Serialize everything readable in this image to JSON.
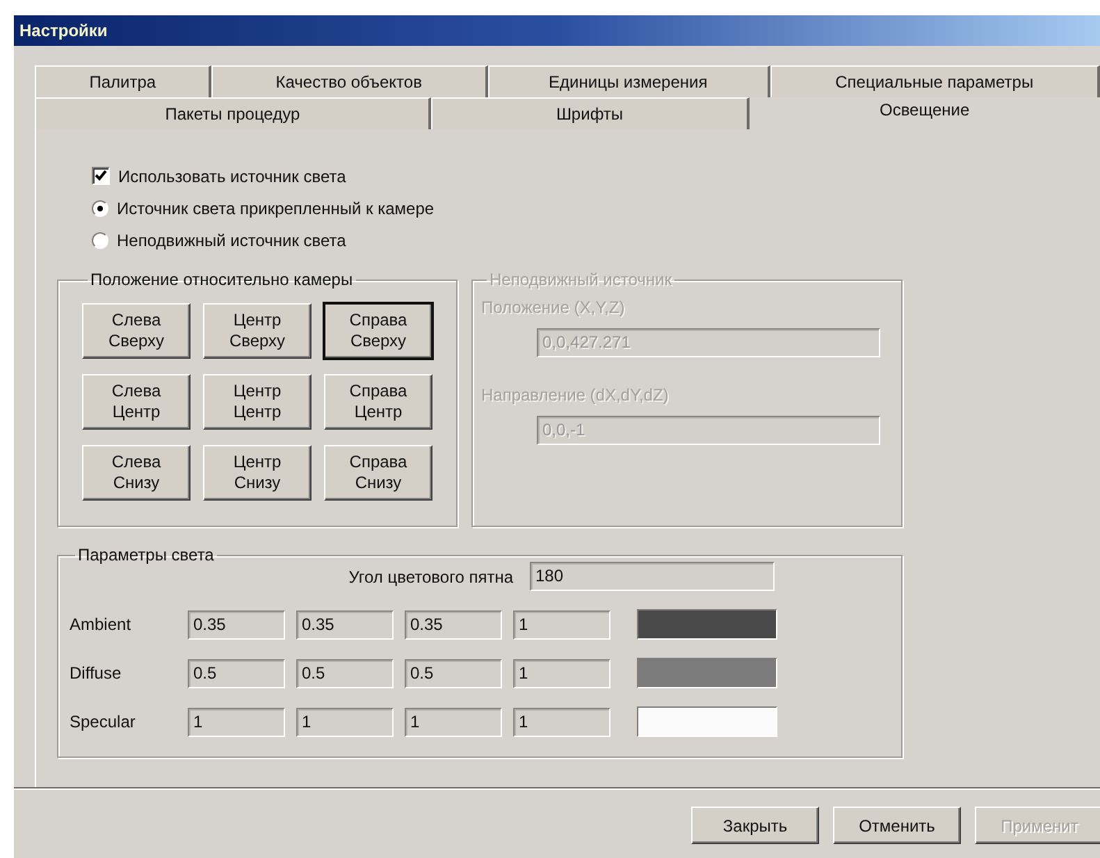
{
  "window": {
    "title": "Настройки"
  },
  "tab_rows": [
    {
      "tabs": [
        {
          "label": "Палитра",
          "selected": false
        },
        {
          "label": "Качество объектов",
          "selected": false
        },
        {
          "label": "Единицы измерения",
          "selected": false
        },
        {
          "label": "Специальные параметры",
          "selected": false
        }
      ]
    },
    {
      "tabs": [
        {
          "label": "Пакеты процедур",
          "selected": false
        },
        {
          "label": "Шрифты",
          "selected": false
        },
        {
          "label": "Освещение",
          "selected": true
        }
      ]
    }
  ],
  "use_light": {
    "label": "Использовать источник света",
    "checked": true
  },
  "light_source": [
    {
      "label": "Источник света прикрепленный к камере",
      "selected": true
    },
    {
      "label": "Неподвижный источник света",
      "selected": false
    }
  ],
  "camera_position": {
    "title": "Положение относительно камеры",
    "buttons": [
      {
        "label": "Слева\nСверху",
        "selected": false
      },
      {
        "label": "Центр\nСверху",
        "selected": false
      },
      {
        "label": "Справа\nСверху",
        "selected": true
      },
      {
        "label": "Слева\nЦентр",
        "selected": false
      },
      {
        "label": "Центр\nЦентр",
        "selected": false
      },
      {
        "label": "Справа\nЦентр",
        "selected": false
      },
      {
        "label": "Слева\nСнизу",
        "selected": false
      },
      {
        "label": "Центр\nСнизу",
        "selected": false
      },
      {
        "label": "Справа\nСнизу",
        "selected": false
      }
    ]
  },
  "fixed_source": {
    "title": "Неподвижный источник",
    "disabled": true,
    "fields": [
      {
        "label": "Положение (X,Y,Z)",
        "value": "0,0,427.271"
      },
      {
        "label": "Направление (dX,dY,dZ)",
        "value": "0,0,-1"
      }
    ]
  },
  "light_params": {
    "title": "Параметры света",
    "spot_angle": {
      "label": "Угол цветового пятна",
      "value": "180"
    },
    "rows": [
      {
        "name": "Ambient",
        "values": [
          "0.35",
          "0.35",
          "0.35",
          "1"
        ],
        "color": "#4a4a4a"
      },
      {
        "name": "Diffuse",
        "values": [
          "0.5",
          "0.5",
          "0.5",
          "1"
        ],
        "color": "#7b7b7b"
      },
      {
        "name": "Specular",
        "values": [
          "1",
          "1",
          "1",
          "1"
        ],
        "color": "#fbfbfb"
      }
    ]
  },
  "buttons": [
    {
      "label": "Закрыть",
      "disabled": false
    },
    {
      "label": "Отменить",
      "disabled": false
    },
    {
      "label": "Применит",
      "disabled": true
    }
  ]
}
